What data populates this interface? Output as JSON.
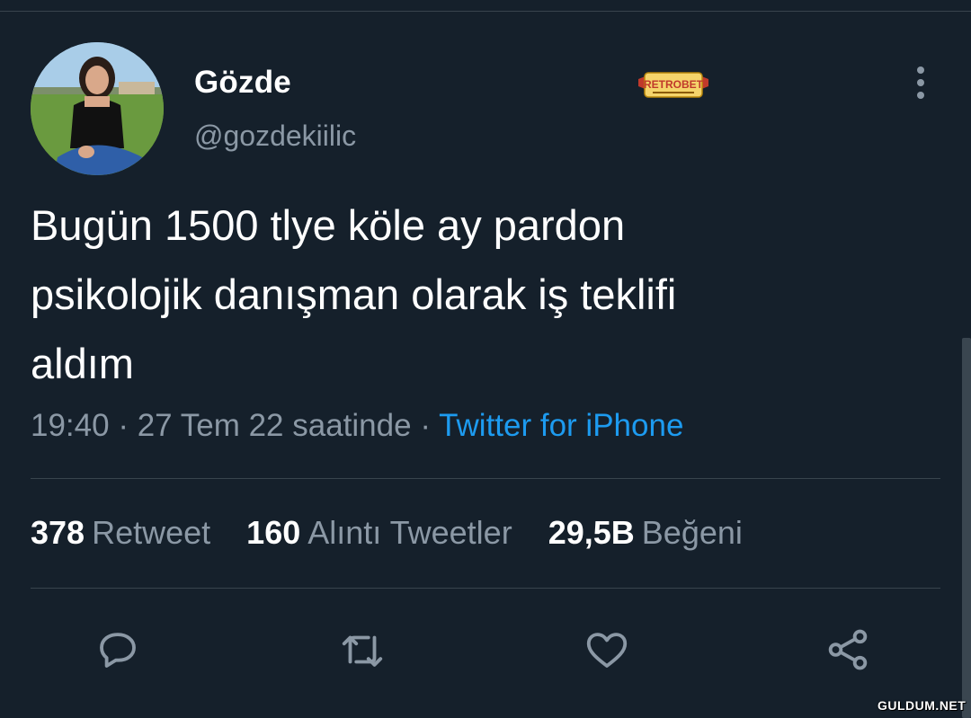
{
  "tweet": {
    "display_name": "Gözde",
    "handle": "@gozdekiilic",
    "lines": [
      "Bugün 1500 tlye köle ay pardon",
      "psikolojik danışman olarak iş teklifi",
      "aldım"
    ],
    "time": "19:40",
    "separator": "·",
    "date": "27 Tem 22 saatinde",
    "source": "Twitter for iPhone"
  },
  "stats": {
    "retweets": {
      "count": "378",
      "label": "Retweet"
    },
    "quotes": {
      "count": "160",
      "label": "Alıntı Tweetler"
    },
    "likes": {
      "count": "29,5B",
      "label": "Beğeni"
    }
  },
  "icons": {
    "more": "more-vertical-icon",
    "reply": "reply-icon",
    "retweet": "retweet-icon",
    "like": "heart-icon",
    "share": "share-icon"
  },
  "watermarks": {
    "logo_text": "RETROBET",
    "site": "GULDUM.NET"
  },
  "colors": {
    "background": "#15202b",
    "muted": "#8b98a5",
    "link": "#1d9bf0",
    "divider": "#38444d"
  }
}
